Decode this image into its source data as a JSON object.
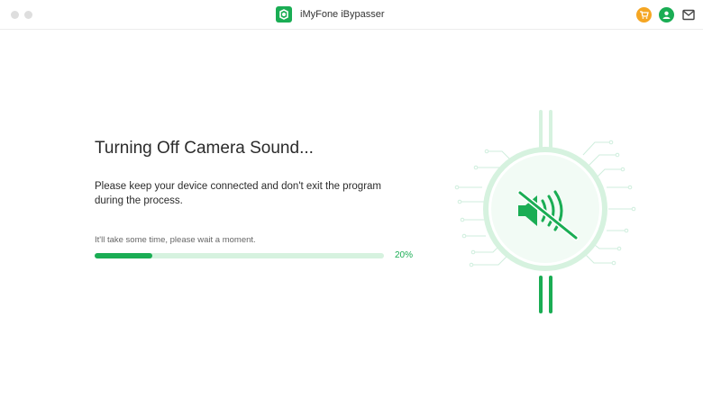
{
  "window": {
    "title": "iMyFone iBypasser"
  },
  "toolbar": {
    "cart_icon": "cart-icon",
    "account_icon": "user-icon",
    "mail_icon": "mail-icon"
  },
  "main": {
    "heading": "Turning Off Camera Sound...",
    "description": "Please keep your device connected and don't exit the program during the process.",
    "wait_note": "It'll take some time, please wait a moment.",
    "progress": {
      "fraction": 0.2,
      "label": "20%"
    }
  },
  "illustration": {
    "icon": "speaker-muted-icon"
  },
  "colors": {
    "accent": "#1aad54",
    "accent_light": "#d6f2df",
    "cart": "#f5a623"
  }
}
